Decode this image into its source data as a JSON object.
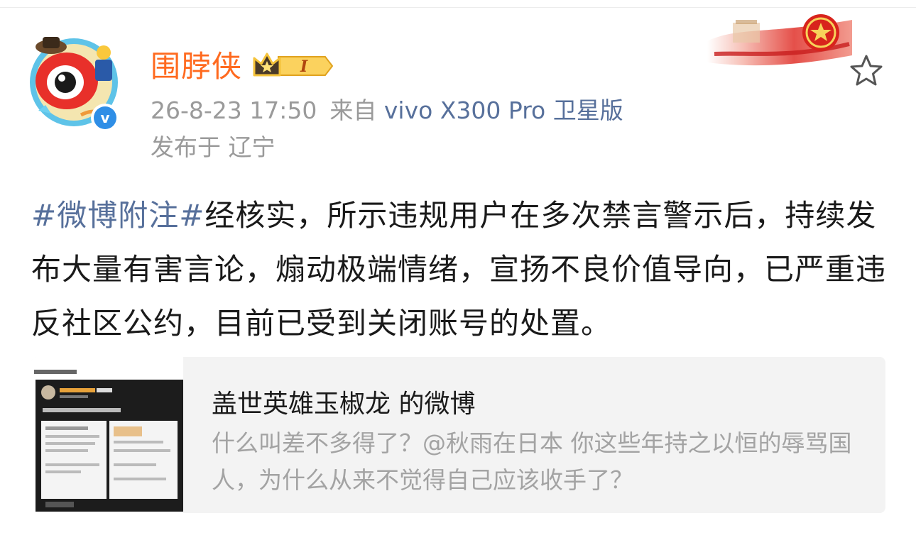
{
  "user": {
    "name": "围脖侠",
    "badge_level": "I",
    "verified_mark": "v",
    "avatar_icon": "weibo-eye-mascot-icon"
  },
  "meta": {
    "date": "26-8-23 17:50",
    "source_prefix": "来自",
    "device": "vivo X300 Pro 卫星版",
    "location": "发布于 辽宁"
  },
  "actions": {
    "favorite_icon": "star-outline-icon"
  },
  "post": {
    "hashtag": "#微博附注#",
    "text": "经核实，所示违规用户在多次禁言警示后，持续发布大量有害言论，煽动极端情绪，宣扬不良价值导向，已严重违反社区公约，目前已受到关闭账号的处置。"
  },
  "repost": {
    "title": "盖世英雄玉椒龙 的微博",
    "excerpt": "什么叫差不多得了？@秋雨在日本  你这些年持之以恒的辱骂国人，为什么从来不觉得自己应该收手了？",
    "thumbnail_icon": "screenshot-thumbnail"
  },
  "colors": {
    "username": "#ff6a1f",
    "link": "#57709b",
    "meta": "#9a9a9a",
    "verified": "#2f8ee6",
    "card_bg": "#f3f3f3"
  }
}
